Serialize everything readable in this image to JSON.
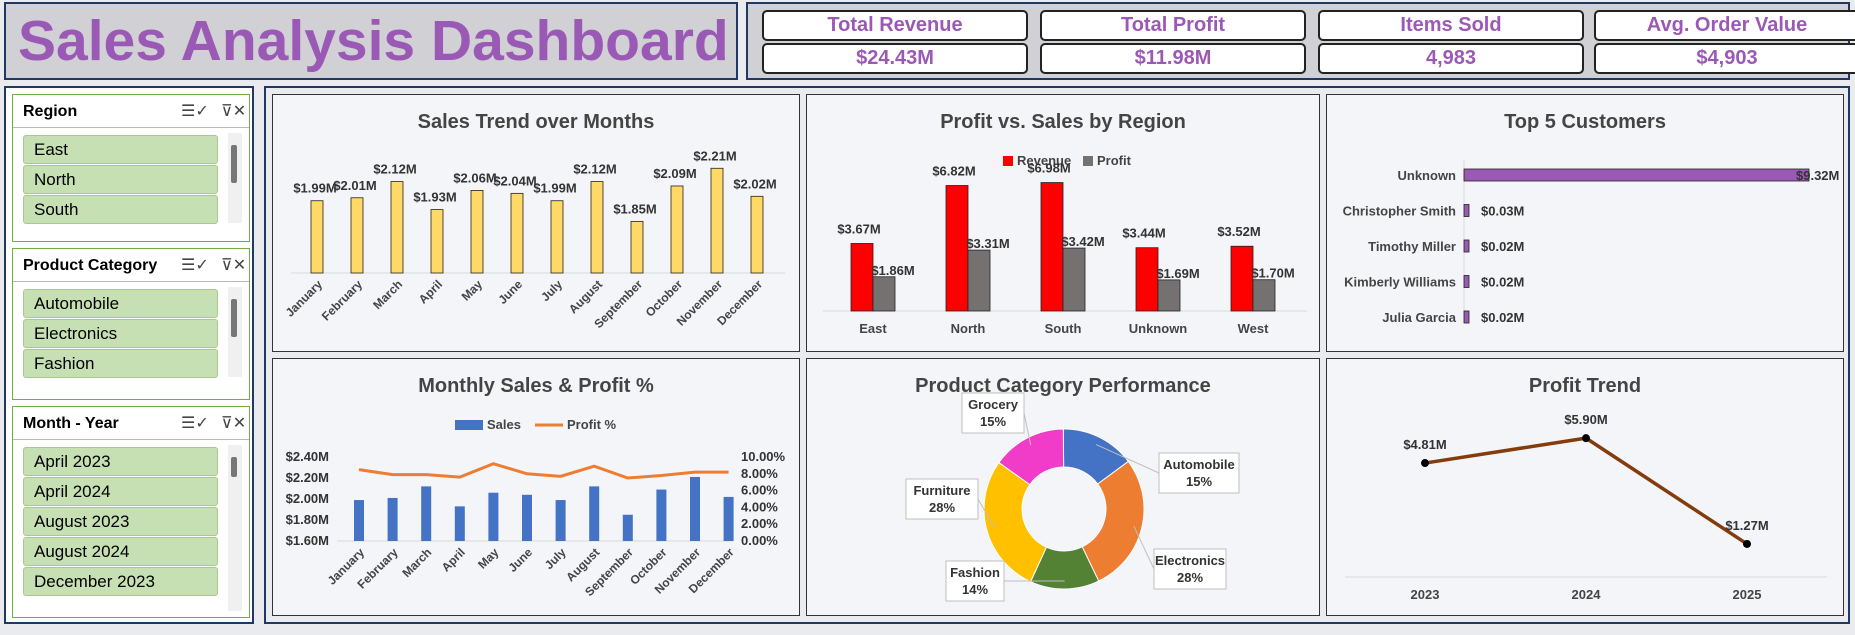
{
  "header": {
    "title": "Sales Analysis Dashboard"
  },
  "kpis": [
    {
      "label": "Total Revenue",
      "value": "$24.43M"
    },
    {
      "label": "Total Profit",
      "value": "$11.98M"
    },
    {
      "label": "Items Sold",
      "value": "4,983"
    },
    {
      "label": "Avg. Order Value",
      "value": "$4,903"
    }
  ],
  "slicers": [
    {
      "title": "Region",
      "items": [
        "East",
        "North",
        "South"
      ]
    },
    {
      "title": "Product Category",
      "items": [
        "Automobile",
        "Electronics",
        "Fashion"
      ]
    },
    {
      "title": "Month - Year",
      "items": [
        "April 2023",
        "April 2024",
        "August 2023",
        "August 2024",
        "December 2023"
      ]
    }
  ],
  "icons": {
    "multi_select": "multi-select-icon",
    "clear_filter": "clear-filter-icon"
  },
  "colors": {
    "title": "#9b59b6",
    "slicer_item": "#c6e0b4",
    "revenue": "#ff0000",
    "profit": "#767171",
    "sales_bar": "#4472c4",
    "profit_line": "#ed7d31",
    "trend_bar": "#ffd966",
    "customer_bar": "#9b59b6",
    "profit_trend": "#843c0c"
  },
  "chart_data": [
    {
      "type": "bar",
      "title": "Sales Trend over Months",
      "categories": [
        "January",
        "February",
        "March",
        "April",
        "May",
        "June",
        "July",
        "August",
        "September",
        "October",
        "November",
        "December"
      ],
      "values": [
        1.99,
        2.01,
        2.12,
        1.93,
        2.06,
        2.04,
        1.99,
        2.12,
        1.85,
        2.09,
        2.21,
        2.02
      ],
      "labels": [
        "$1.99M",
        "$2.01M",
        "$2.12M",
        "$1.93M",
        "$2.06M",
        "$2.04M",
        "$1.99M",
        "$2.12M",
        "$1.85M",
        "$2.09M",
        "$2.21M",
        "$2.02M"
      ],
      "ylim": [
        1.5,
        2.3
      ],
      "grid": false
    },
    {
      "type": "bar",
      "title": "Profit vs. Sales by Region",
      "categories": [
        "East",
        "North",
        "South",
        "Unknown",
        "West"
      ],
      "series": [
        {
          "name": "Revenue",
          "values": [
            3.67,
            6.82,
            6.98,
            3.44,
            3.52
          ],
          "labels": [
            "$3.67M",
            "$6.82M",
            "$6.98M",
            "$3.44M",
            "$3.52M"
          ]
        },
        {
          "name": "Profit",
          "values": [
            1.86,
            3.31,
            3.42,
            1.69,
            1.7
          ],
          "labels": [
            "$1.86M",
            "$3.31M",
            "$3.42M",
            "$1.69M",
            "$1.70M"
          ]
        }
      ],
      "legend": "top",
      "ylim": [
        0,
        8
      ]
    },
    {
      "type": "bar",
      "orientation": "horizontal",
      "title": "Top 5 Customers",
      "categories": [
        "Unknown",
        "Christopher Smith",
        "Timothy Miller",
        "Kimberly Williams",
        "Julia Garcia"
      ],
      "values": [
        9.32,
        0.03,
        0.02,
        0.02,
        0.02
      ],
      "labels": [
        "$9.32M",
        "$0.03M",
        "$0.02M",
        "$0.02M",
        "$0.02M"
      ]
    },
    {
      "type": "bar",
      "title": "Monthly Sales & Profit %",
      "categories": [
        "January",
        "February",
        "March",
        "April",
        "May",
        "June",
        "July",
        "August",
        "September",
        "October",
        "November",
        "December"
      ],
      "series": [
        {
          "name": "Sales",
          "type": "bar",
          "values": [
            1.99,
            2.01,
            2.12,
            1.93,
            2.06,
            2.04,
            1.99,
            2.12,
            1.85,
            2.09,
            2.21,
            2.02
          ]
        },
        {
          "name": "Profit %",
          "type": "line",
          "axis": "secondary",
          "values": [
            8.5,
            7.9,
            7.9,
            7.6,
            9.2,
            8.0,
            7.7,
            8.9,
            7.5,
            7.8,
            8.2,
            8.2
          ]
        }
      ],
      "y_ticks": [
        "$1.60M",
        "$1.80M",
        "$2.00M",
        "$2.20M",
        "$2.40M"
      ],
      "ylim": [
        1.6,
        2.4
      ],
      "y2_ticks": [
        "0.00%",
        "2.00%",
        "4.00%",
        "6.00%",
        "8.00%",
        "10.00%"
      ],
      "y2lim": [
        0,
        10
      ],
      "legend": "top"
    },
    {
      "type": "pie",
      "style": "donut",
      "title": "Product Category Performance",
      "categories": [
        "Automobile",
        "Electronics",
        "Fashion",
        "Furniture",
        "Grocery"
      ],
      "values": [
        15,
        28,
        14,
        28,
        15
      ],
      "labels": [
        "15%",
        "28%",
        "14%",
        "28%",
        "15%"
      ],
      "colors": [
        "#4472c4",
        "#ed7d31",
        "#548235",
        "#ffc000",
        "#f03cc8"
      ]
    },
    {
      "type": "line",
      "title": "Profit Trend",
      "categories": [
        "2023",
        "2024",
        "2025"
      ],
      "values": [
        4.81,
        5.9,
        1.27
      ],
      "labels": [
        "$4.81M",
        "$5.90M",
        "$1.27M"
      ],
      "ylim": [
        0,
        7
      ]
    }
  ]
}
